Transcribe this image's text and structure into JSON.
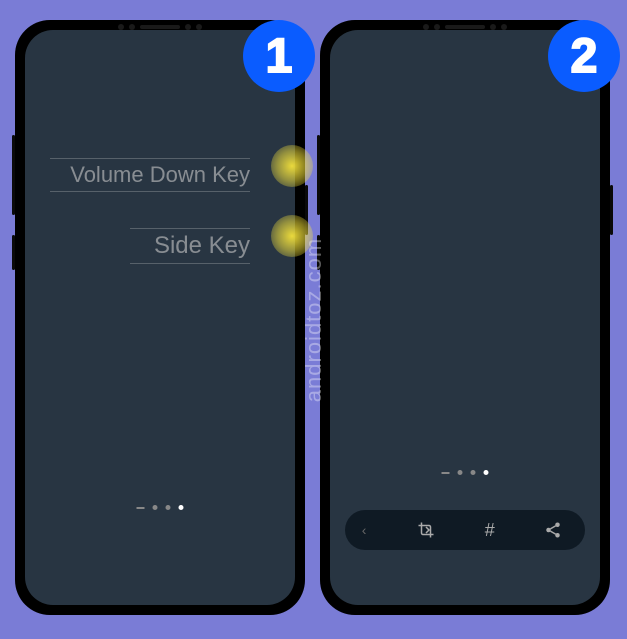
{
  "step1": {
    "badge": "1",
    "label_volume_down": "Volume Down Key",
    "label_side_key": "Side Key"
  },
  "step2": {
    "badge": "2",
    "toolbar": {
      "crop_icon": "crop-icon",
      "hash_icon": "#",
      "share_icon": "share-icon"
    }
  },
  "watermark": "androidtoz.com"
}
